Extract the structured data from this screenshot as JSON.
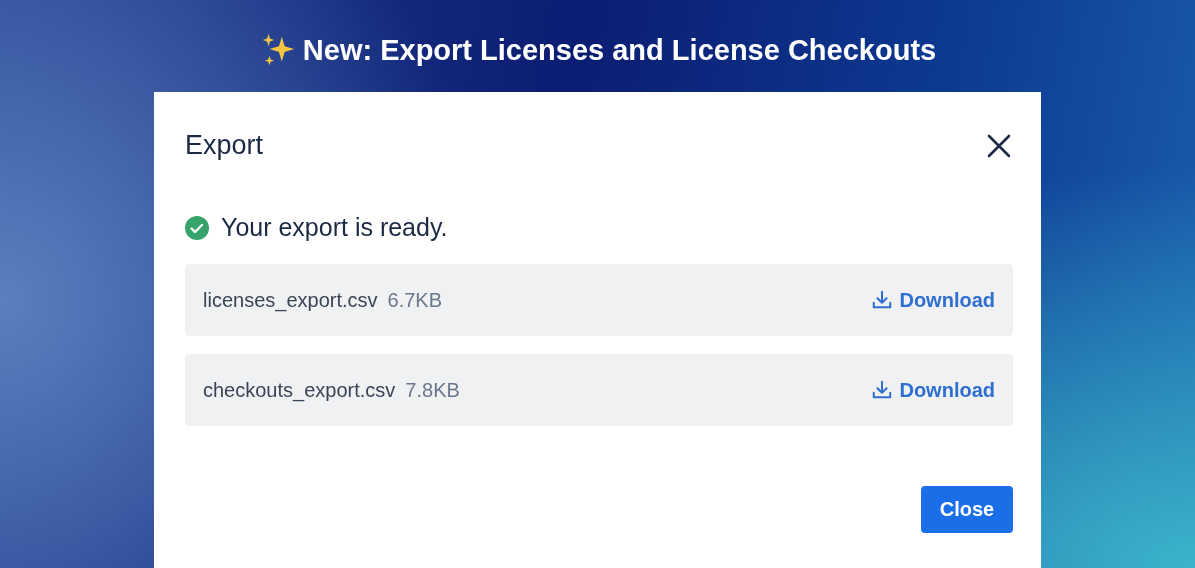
{
  "banner": {
    "title": "New: Export Licenses and License Checkouts"
  },
  "dialog": {
    "title": "Export",
    "status": "Your export is ready.",
    "files": [
      {
        "name": "licenses_export.csv",
        "size": "6.7KB",
        "action": "Download"
      },
      {
        "name": "checkouts_export.csv",
        "size": "7.8KB",
        "action": "Download"
      }
    ],
    "buttons": [
      "Close"
    ]
  }
}
